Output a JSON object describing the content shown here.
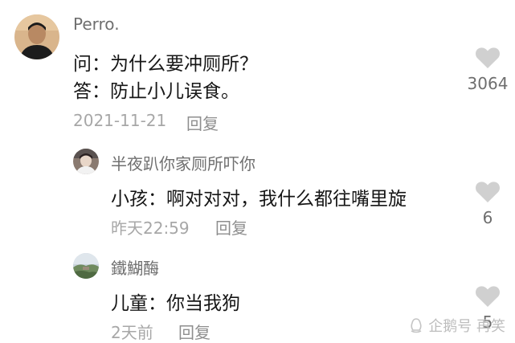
{
  "comments": [
    {
      "username": "Perro.",
      "lines": [
        "问：为什么要冲厕所？",
        "答：防止小儿误食。"
      ],
      "date": "2021-11-21",
      "reply_label": "回复",
      "likes": "3064",
      "avatar_icon": "user-avatar-photo"
    },
    {
      "username": "半夜趴你家厕所吓你",
      "lines": [
        "小孩：啊对对对，我什么都往嘴里旋"
      ],
      "date": "昨天22:59",
      "reply_label": "回复",
      "likes": "6",
      "avatar_icon": "user-avatar-photo"
    },
    {
      "username": "鐵鰗酶",
      "lines": [
        "儿童：你当我狗"
      ],
      "date": "2天前",
      "reply_label": "回复",
      "likes": "5",
      "avatar_icon": "landscape-avatar-photo"
    }
  ],
  "watermark": {
    "text": "企鹅号 再笑",
    "icon": "penguin-logo-icon"
  },
  "colors": {
    "heart": "#d0d0d0",
    "username": "#6f6f6f",
    "meta": "#a7a7a7"
  }
}
